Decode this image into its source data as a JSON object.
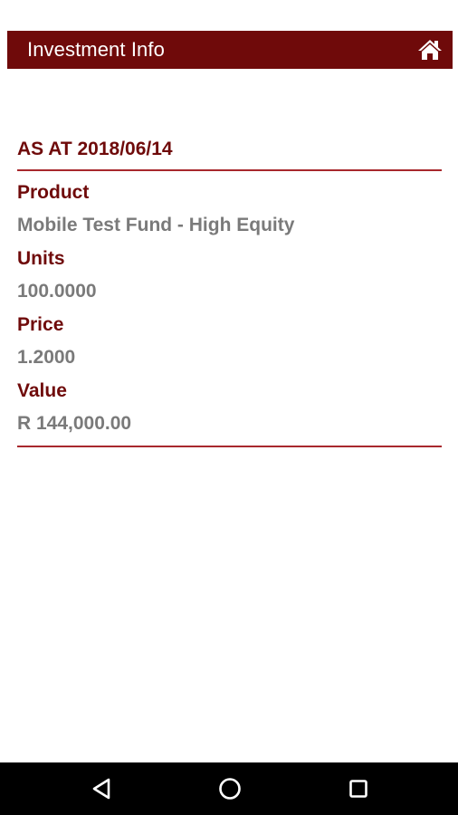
{
  "header": {
    "title": "Investment Info",
    "home_icon": "home-icon",
    "bg_color": "#6f0a0a"
  },
  "statement": {
    "as_at": "AS AT 2018/06/14"
  },
  "fields": {
    "product_label": "Product",
    "product_value": "Mobile Test Fund - High Equity",
    "units_label": "Units",
    "units_value": "100.0000",
    "price_label": "Price",
    "price_value": "1.2000",
    "value_label": "Value",
    "value_value": "R 144,000.00"
  },
  "colors": {
    "accent": "#6f0a0a",
    "divider": "#a8282d",
    "value_text": "#7a7a7a"
  },
  "nav_bar": {
    "back_icon": "back-triangle-icon",
    "home_icon": "home-circle-icon",
    "recent_icon": "recent-square-icon"
  }
}
